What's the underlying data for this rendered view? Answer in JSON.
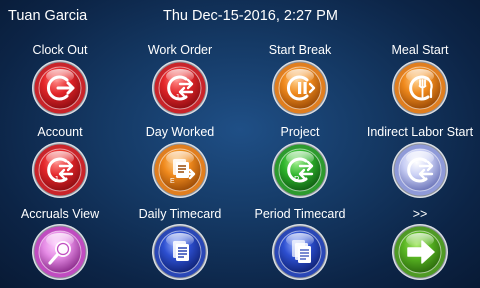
{
  "header": {
    "user_name": "Tuan Garcia",
    "datetime": "Thu Dec-15-2016, 2:27 PM"
  },
  "colors": {
    "red": {
      "rim": "#c9242a",
      "light": "#ff8a86",
      "mid": "#e4262a",
      "dark": "#8e0d12"
    },
    "orange": {
      "rim": "#e07e1f",
      "light": "#ffd190",
      "mid": "#f08a1d",
      "dark": "#9a4a06"
    },
    "green": {
      "rim": "#2d9a2e",
      "light": "#9dee8a",
      "mid": "#2fb52c",
      "dark": "#0f5d12"
    },
    "blue": {
      "rim": "#2a47b6",
      "light": "#9cb4ff",
      "mid": "#2d4fd0",
      "dark": "#0f2275"
    },
    "lav": {
      "rim": "#8f9ad8",
      "light": "#ffffff",
      "mid": "#c9cff5",
      "dark": "#6b74b8"
    },
    "pink": {
      "rim": "#c04cc0",
      "light": "#ffd3ff",
      "mid": "#e58be5",
      "dark": "#8a2a8a"
    },
    "go": {
      "rim": "#4f9a25",
      "light": "#a8e86a",
      "mid": "#58b522",
      "dark": "#2c6a0d"
    }
  },
  "tiles": [
    {
      "label": "Clock Out",
      "icon": "clock-out-icon",
      "color": "red",
      "selected": true
    },
    {
      "label": "Work Order",
      "icon": "work-order-icon",
      "color": "red",
      "selected": false
    },
    {
      "label": "Start Break",
      "icon": "start-break-icon",
      "color": "orange",
      "selected": false
    },
    {
      "label": "Meal Start",
      "icon": "meal-start-icon",
      "color": "orange",
      "selected": false
    },
    {
      "label": "Account",
      "icon": "account-icon",
      "color": "red",
      "selected": false
    },
    {
      "label": "Day Worked",
      "icon": "day-worked-icon",
      "color": "orange",
      "selected": false
    },
    {
      "label": "Project",
      "icon": "project-icon",
      "color": "green",
      "selected": false
    },
    {
      "label": "Indirect Labor Start",
      "icon": "indirect-labor-icon",
      "color": "lav",
      "selected": false
    },
    {
      "label": "Accruals View",
      "icon": "accruals-view-icon",
      "color": "pink",
      "selected": false
    },
    {
      "label": "Daily Timecard",
      "icon": "daily-timecard-icon",
      "color": "blue",
      "selected": false
    },
    {
      "label": "Period Timecard",
      "icon": "period-timecard-icon",
      "color": "blue",
      "selected": false
    },
    {
      "label": ">>",
      "icon": "next-arrow-icon",
      "color": "go",
      "selected": false
    }
  ]
}
